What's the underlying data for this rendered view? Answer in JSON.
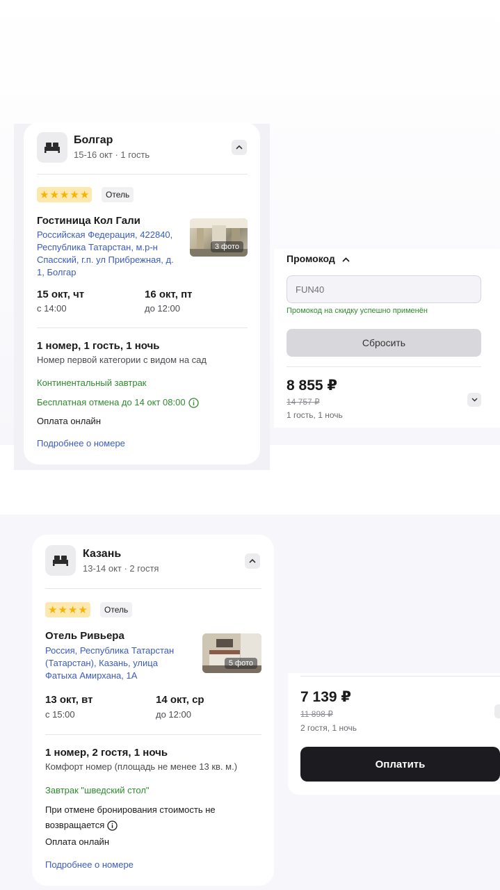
{
  "card1": {
    "city": "Болгар",
    "dates_guests": "15-16 окт · 1 гость",
    "stars": 5,
    "type": "Отель",
    "hotel_name": "Гостиница Кол Гали",
    "address": "Российская Федерация, 422840, Республика Татарстан, м.р-н Спасский, г.п. ул Прибрежная, д. 1, Болгар",
    "photo_count": "3 фото",
    "checkin_date": "15 окт, чт",
    "checkin_time": "с 14:00",
    "checkout_date": "16 окт, пт",
    "checkout_time": "до 12:00",
    "rooms": "1 номер, 1 гость, 1 ночь",
    "room_type": "Номер первой категории с видом на сад",
    "meal": "Континентальный завтрак",
    "cancellation": "Бесплатная отмена до 14 окт 08:00",
    "payment": "Оплата онлайн",
    "details_link": "Подробнее о номере"
  },
  "panel1": {
    "promo_label": "Промокод",
    "promo_value": "FUN40",
    "promo_success": "Промокод на скидку успешно применён",
    "reset_label": "Сбросить",
    "price": "8 855 ₽",
    "old_price": "14 757 ₽",
    "meta": "1 гость, 1 ночь"
  },
  "card2": {
    "city": "Казань",
    "dates_guests": "13-14 окт · 2 гостя",
    "stars": 4,
    "type": "Отель",
    "hotel_name": "Отель Ривьера",
    "address": "Россия, Республика Татарстан (Татарстан), Казань, улица Фатыха Амирхана, 1А",
    "photo_count": "5 фото",
    "checkin_date": "13 окт, вт",
    "checkin_time": "с 15:00",
    "checkout_date": "14 окт, ср",
    "checkout_time": "до 12:00",
    "rooms": "1 номер, 2 гостя, 1 ночь",
    "room_type": "Комфорт номер (площадь не менее 13 кв. м.)",
    "meal": "Завтрак \"шведский стол\"",
    "cancellation": "При отмене бронирования стоимость не возвращается",
    "payment": "Оплата онлайн",
    "details_link": "Подробнее о номере"
  },
  "panel2": {
    "price": "7 139 ₽",
    "old_price": "11 898 ₽",
    "meta": "2 гостя, 1 ночь",
    "pay_label": "Оплатить"
  }
}
